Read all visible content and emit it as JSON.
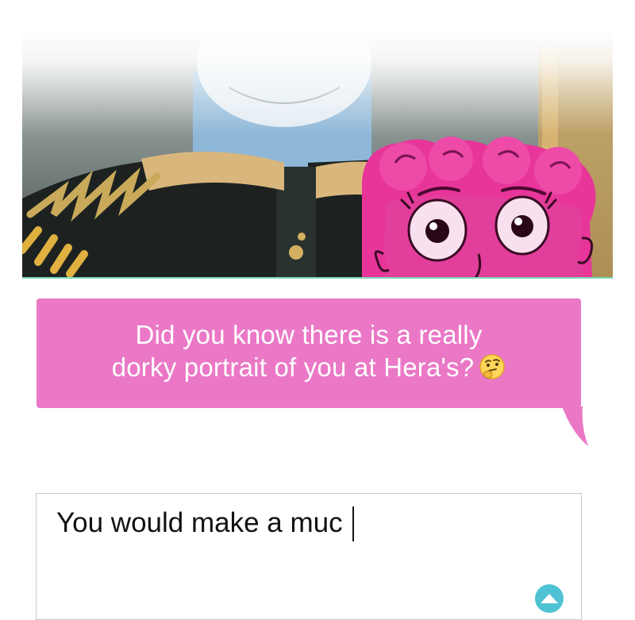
{
  "colors": {
    "bubble": "#ea78c6",
    "bubble_text": "#ffffff",
    "panel_accent_line": "#7bd8b8",
    "send_button": "#4fc3d3",
    "character_pink": "#e8359a"
  },
  "panel": {
    "description_icon": "comic-panel-image"
  },
  "message": {
    "line1": "Did you know there is a really",
    "line2": "dorky portrait of you at Hera's?",
    "emoji_icon": "thinking-face-icon"
  },
  "composer": {
    "typed_text": "You would make a muc",
    "send_icon": "send-arrow-up-icon"
  }
}
